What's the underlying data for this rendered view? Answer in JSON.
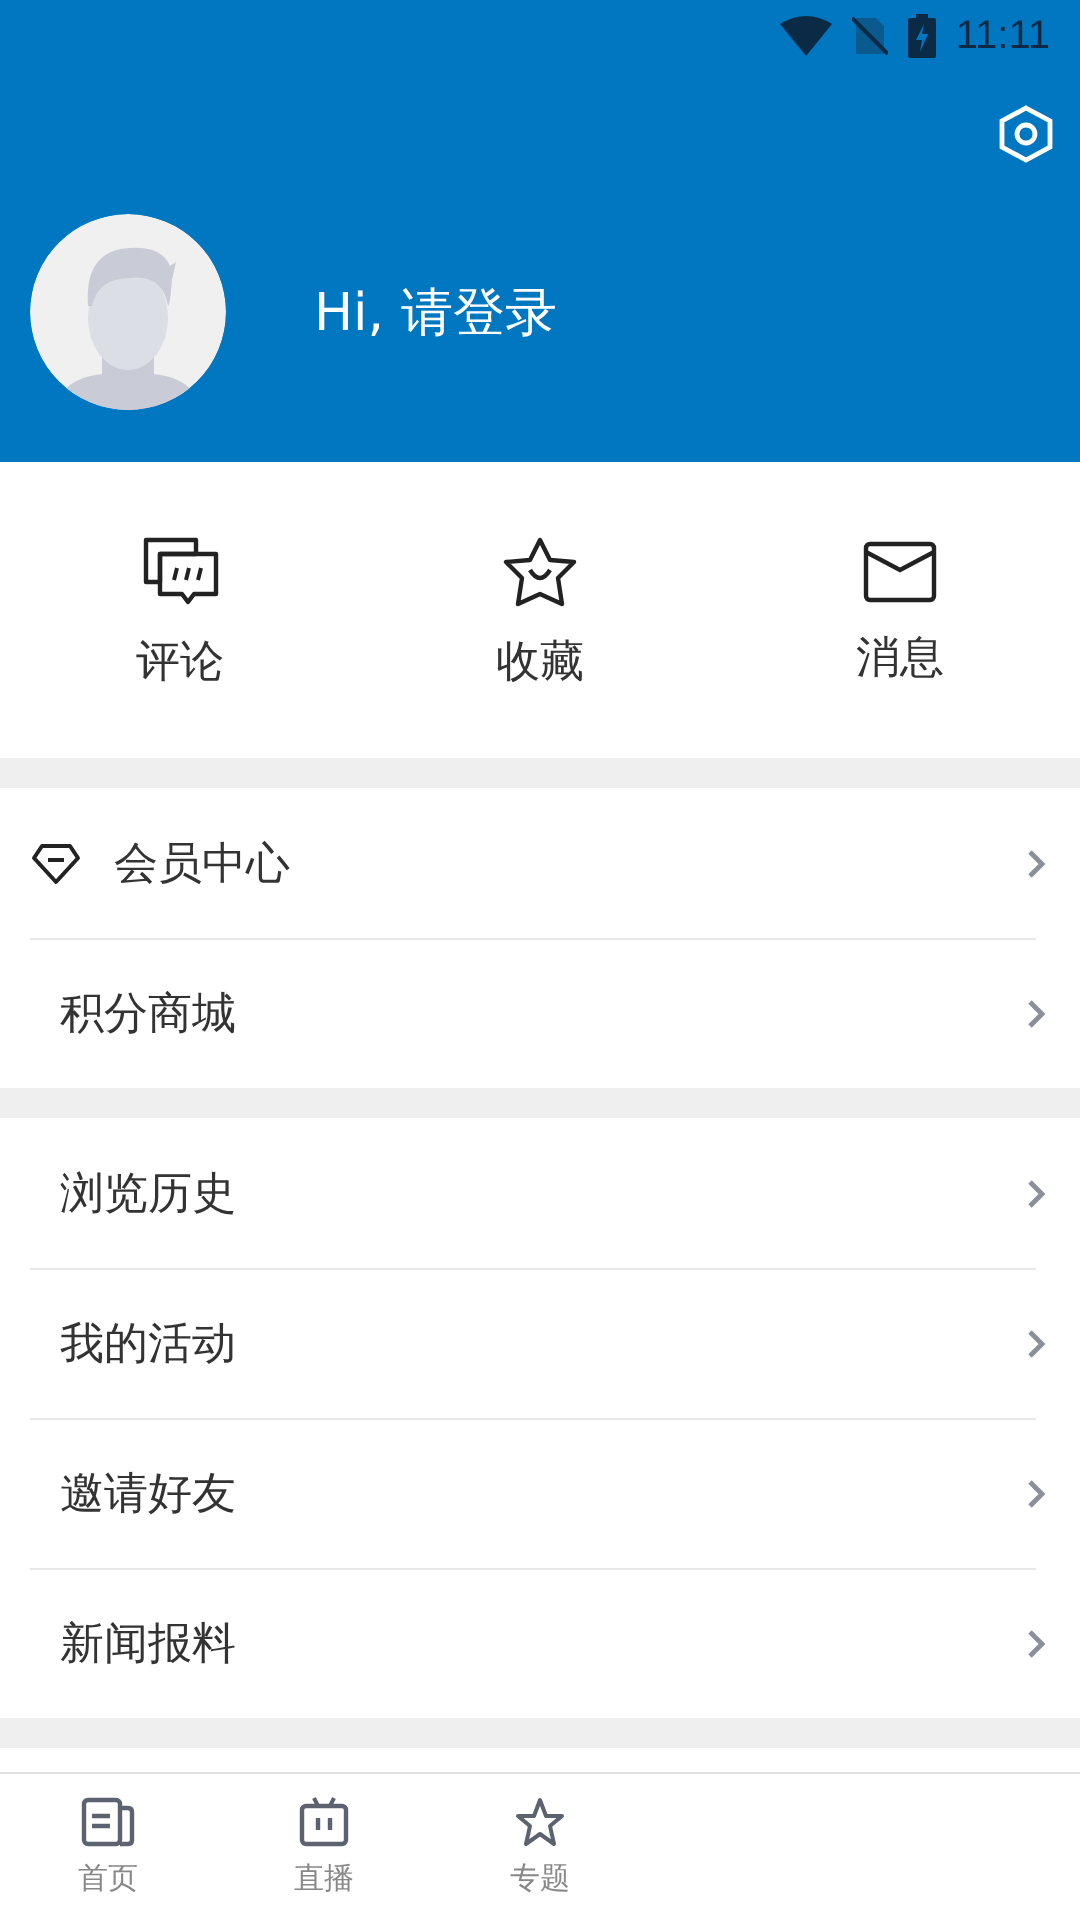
{
  "status_bar": {
    "time": "11:11"
  },
  "header": {
    "greeting": "Hi, 请登录"
  },
  "quick_actions": [
    {
      "kind": "comment",
      "label": "评论"
    },
    {
      "kind": "star",
      "label": "收藏"
    },
    {
      "kind": "mail",
      "label": "消息"
    }
  ],
  "menu_groups": [
    [
      {
        "label": "会员中心",
        "kind": "diamond"
      },
      {
        "label": "积分商城",
        "kind": "plain"
      }
    ],
    [
      {
        "label": "浏览历史",
        "kind": "plain"
      },
      {
        "label": "我的活动",
        "kind": "plain"
      },
      {
        "label": "邀请好友",
        "kind": "plain"
      },
      {
        "label": "新闻报料",
        "kind": "plain"
      }
    ]
  ],
  "bottom_nav": [
    {
      "kind": "news",
      "label": "首页"
    },
    {
      "kind": "tv",
      "label": "直播"
    },
    {
      "kind": "star",
      "label": "专题"
    }
  ]
}
